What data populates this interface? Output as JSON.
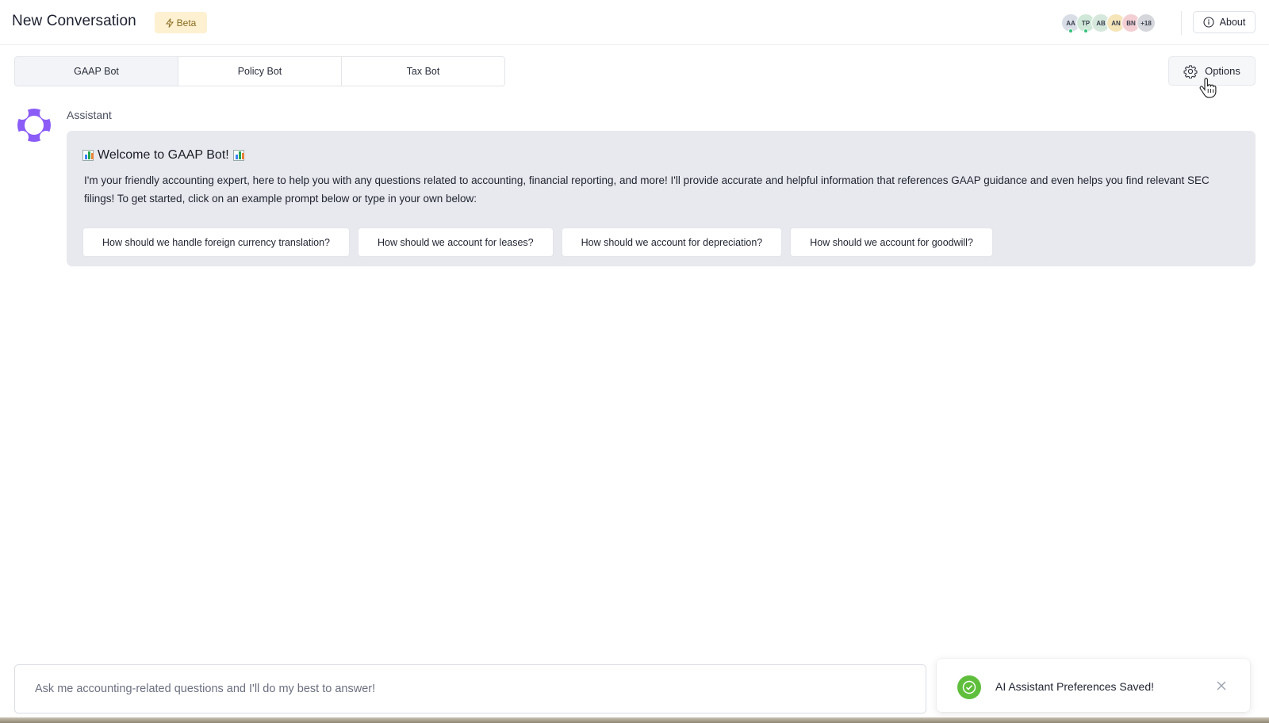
{
  "header": {
    "title": "New Conversation",
    "beta_label": "Beta",
    "avatars": [
      {
        "initials": "AA",
        "color": "#d9dde6",
        "online": true
      },
      {
        "initials": "TP",
        "color": "#cfe8d8",
        "online": true
      },
      {
        "initials": "AB",
        "color": "#d6e7dc",
        "online": false
      },
      {
        "initials": "AN",
        "color": "#f6e5b9",
        "online": false
      },
      {
        "initials": "BN",
        "color": "#f3cfd3",
        "online": false
      },
      {
        "initials": "+18",
        "color": "#d5d7dc",
        "online": false
      }
    ],
    "about_label": "About"
  },
  "tabs": [
    {
      "label": "GAAP Bot",
      "active": true
    },
    {
      "label": "Policy Bot",
      "active": false
    },
    {
      "label": "Tax Bot",
      "active": false
    }
  ],
  "options_label": "Options",
  "message": {
    "author": "Assistant",
    "title": "Welcome to GAAP Bot!",
    "body": "I'm your friendly accounting expert, here to help you with any questions related to accounting, financial reporting, and more! I'll provide accurate and helpful information that references GAAP guidance and even helps you find relevant SEC filings! To get started, click on an example prompt below or type in your own below:",
    "prompts": [
      "How should we handle foreign currency translation?",
      "How should we account for leases?",
      "How should we account for depreciation?",
      "How should we account for goodwill?"
    ]
  },
  "input": {
    "placeholder": "Ask me accounting-related questions and I'll do my best to answer!"
  },
  "toast": {
    "message": "AI Assistant Preferences Saved!",
    "status": "success"
  },
  "colors": {
    "accent_purple": "#8b5cf6",
    "toast_success": "#5fbf3c",
    "beta_bg": "#fdf1d2"
  }
}
